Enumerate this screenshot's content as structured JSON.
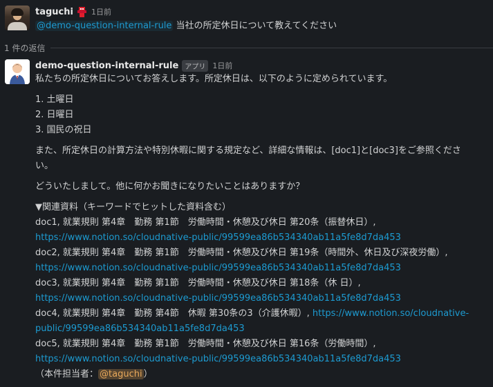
{
  "parent": {
    "username": "taguchi",
    "timestamp": "1日前",
    "mention": "@demo-question-internal-rule",
    "text": " 当社の所定休日について教えてください",
    "status_icon": "red-character-emoji"
  },
  "replies_label": "1 件の返信",
  "reply": {
    "username": "demo-question-internal-rule",
    "app_badge": "アプリ",
    "timestamp": "1日前",
    "intro": "私たちの所定休日についてお答えします。所定休日は、以下のように定められています。",
    "list": [
      "1. 土曜日",
      "2. 日曜日",
      "3. 国民の祝日"
    ],
    "detail_line1": "また、所定休日の計算方法や特別休暇に関する規定など、詳細な情報は、[doc1]と[doc3]をご参照くださ",
    "detail_line2": "い。",
    "closing": "どういたしまして。他に何かお聞きになりたいことはありますか？",
    "refs_heading": "▼関連資料（キーワードでヒットした資料含む）",
    "refs": [
      {
        "text": "doc1, 就業規則 第4章　勤務 第1節　労働時間・休憩及び休日 第20条（振替休日）,",
        "url": "https://www.notion.so/cloudnative-public/99599ea86b534340ab11a5fe8d7da453"
      },
      {
        "text": "doc2, 就業規則 第4章　勤務 第1節　労働時間・休憩及び休日 第19条（時間外、休日及び深夜労働）,",
        "url": "https://www.notion.so/cloudnative-public/99599ea86b534340ab11a5fe8d7da453"
      },
      {
        "text": "doc3, 就業規則 第4章　勤務 第1節　労働時間・休憩及び休日 第18条（休 日）,",
        "url": "https://www.notion.so/cloudnative-public/99599ea86b534340ab11a5fe8d7da453"
      }
    ],
    "doc4_text": "doc4, 就業規則 第4章　勤務 第4節　休暇 第30条の3（介護休暇）, ",
    "doc4_url_part1": "https://www.notion.so/cloudnative-",
    "doc4_url_part2": "public/99599ea86b534340ab11a5fe8d7da453",
    "doc5_text": "doc5, 就業規則 第4章　勤務 第1節　労働時間・休憩及び休日 第16条（労働時間）,",
    "doc5_url": "https://www.notion.so/cloudnative-public/99599ea86b534340ab11a5fe8d7da453",
    "owner_prefix": "（本件担当者：",
    "owner_mention": "@taguchi",
    "owner_suffix": "）"
  },
  "colors": {
    "background": "#1a1d21",
    "text": "#d1d2d3",
    "link": "#1d9bd1",
    "self_mention": "#e8a85a"
  }
}
